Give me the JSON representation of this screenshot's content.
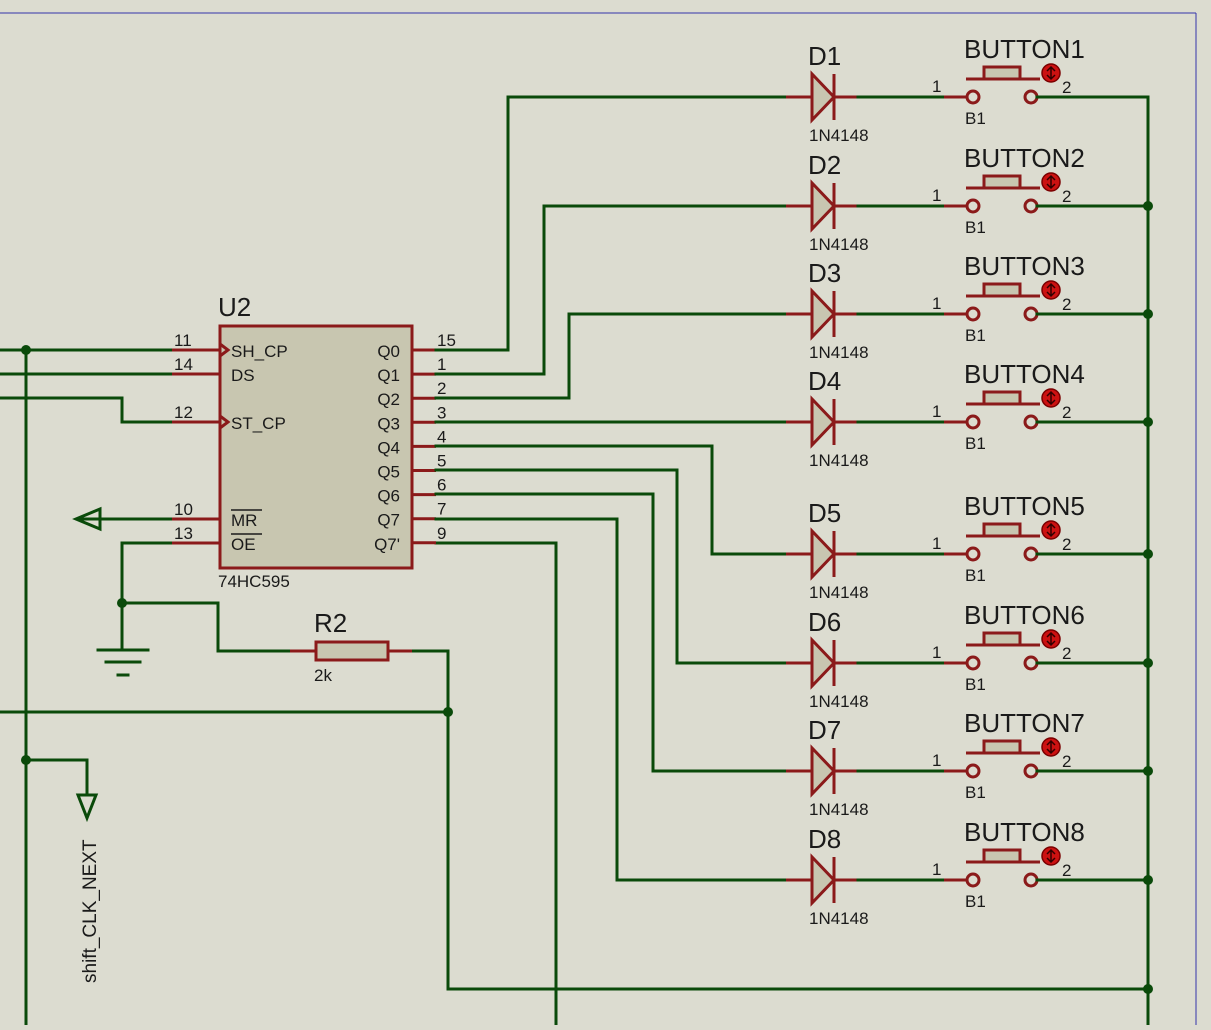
{
  "ic": {
    "ref": "U2",
    "part": "74HC595",
    "left_pins": [
      {
        "num": "11",
        "name": "SH_CP"
      },
      {
        "num": "14",
        "name": "DS"
      },
      {
        "num": "12",
        "name": "ST_CP"
      },
      {
        "num": "10",
        "name": "MR"
      },
      {
        "num": "13",
        "name": "OE"
      }
    ],
    "right_pins": [
      {
        "num": "15",
        "name": "Q0"
      },
      {
        "num": "1",
        "name": "Q1"
      },
      {
        "num": "2",
        "name": "Q2"
      },
      {
        "num": "3",
        "name": "Q3"
      },
      {
        "num": "4",
        "name": "Q4"
      },
      {
        "num": "5",
        "name": "Q5"
      },
      {
        "num": "6",
        "name": "Q6"
      },
      {
        "num": "7",
        "name": "Q7"
      },
      {
        "num": "9",
        "name": "Q7'"
      }
    ]
  },
  "resistor": {
    "ref": "R2",
    "value": "2k"
  },
  "net_label": "shift_CLK_NEXT",
  "rows": [
    {
      "diode": "D1",
      "diode_part": "1N4148",
      "button": "BUTTON1",
      "pin1": "1",
      "pin2": "2",
      "b_label": "B1"
    },
    {
      "diode": "D2",
      "diode_part": "1N4148",
      "button": "BUTTON2",
      "pin1": "1",
      "pin2": "2",
      "b_label": "B1"
    },
    {
      "diode": "D3",
      "diode_part": "1N4148",
      "button": "BUTTON3",
      "pin1": "1",
      "pin2": "2",
      "b_label": "B1"
    },
    {
      "diode": "D4",
      "diode_part": "1N4148",
      "button": "BUTTON4",
      "pin1": "1",
      "pin2": "2",
      "b_label": "B1"
    },
    {
      "diode": "D5",
      "diode_part": "1N4148",
      "button": "BUTTON5",
      "pin1": "1",
      "pin2": "2",
      "b_label": "B1"
    },
    {
      "diode": "D6",
      "diode_part": "1N4148",
      "button": "BUTTON6",
      "pin1": "1",
      "pin2": "2",
      "b_label": "B1"
    },
    {
      "diode": "D7",
      "diode_part": "1N4148",
      "button": "BUTTON7",
      "pin1": "1",
      "pin2": "2",
      "b_label": "B1"
    },
    {
      "diode": "D8",
      "diode_part": "1N4148",
      "button": "BUTTON8",
      "pin1": "1",
      "pin2": "2",
      "b_label": "B1"
    }
  ],
  "colors": {
    "background": "#dcdcd0",
    "wire": "#0a4a0a",
    "component": "#8b1a1a",
    "body_fill": "#c8c6b0"
  }
}
